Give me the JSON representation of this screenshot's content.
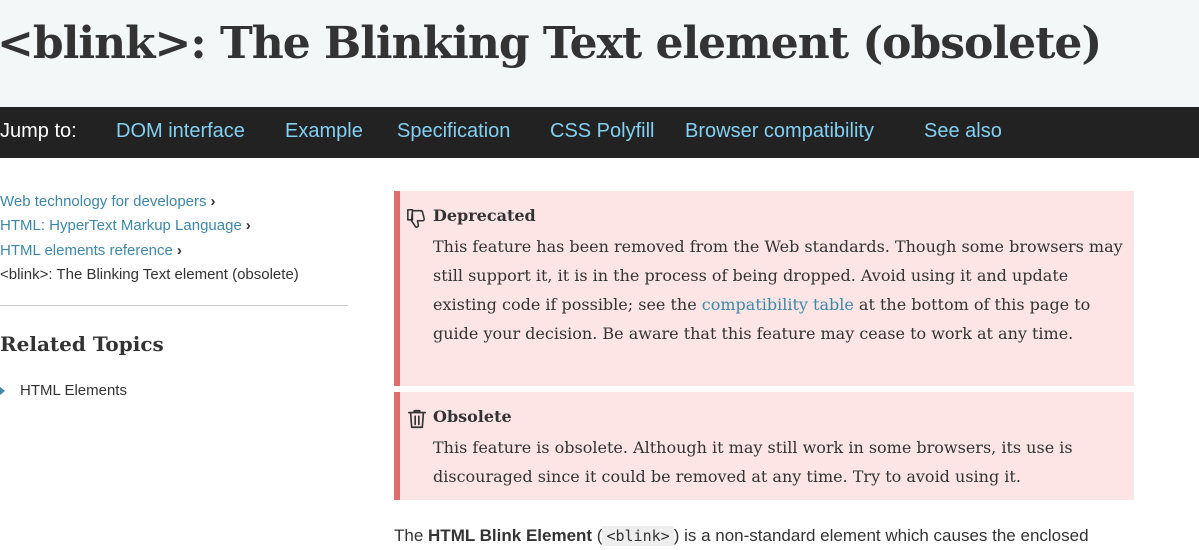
{
  "page": {
    "title": "<blink>: The Blinking Text element (obsolete)"
  },
  "jump_bar": {
    "label": "Jump to:",
    "links": [
      "DOM interface",
      "Example",
      "Specification",
      "CSS Polyfill",
      "Browser compatibility",
      "See also"
    ]
  },
  "breadcrumbs": {
    "items": [
      "Web technology for developers",
      "HTML: HyperText Markup Language",
      "HTML elements reference"
    ],
    "current": "<blink>: The Blinking Text element (obsolete)",
    "separator": "›"
  },
  "sidebar": {
    "related_title": "Related Topics",
    "related_items": [
      "HTML Elements"
    ]
  },
  "notices": {
    "deprecated": {
      "heading": "Deprecated",
      "text_before": "This feature has been removed from the Web standards. Though some browsers may still support it, it is in the process of being dropped. Avoid using it and update existing code if possible; see the ",
      "link": "compatibility table",
      "text_after": " at the bottom of this page to guide your decision. Be aware that this feature may cease to work at any time.",
      "icon": "thumbs-down-icon"
    },
    "obsolete": {
      "heading": "Obsolete",
      "text": "This feature is obsolete. Although it may still work in some browsers, its use is discouraged since it could be removed at any time. Try to avoid using it.",
      "icon": "trash-icon"
    }
  },
  "intro": {
    "before": "The ",
    "bold": "HTML Blink Element",
    "middle": " (",
    "code": "<blink>",
    "after": ") is a non-standard element which causes the enclosed"
  },
  "colors": {
    "jump_bar_bg": "#222222",
    "jump_link": "#83d0f2",
    "link": "#3f87a6",
    "notice_bg": "#fde5e5",
    "notice_border": "#e06d6d",
    "title_bg": "#f4f7f8"
  }
}
